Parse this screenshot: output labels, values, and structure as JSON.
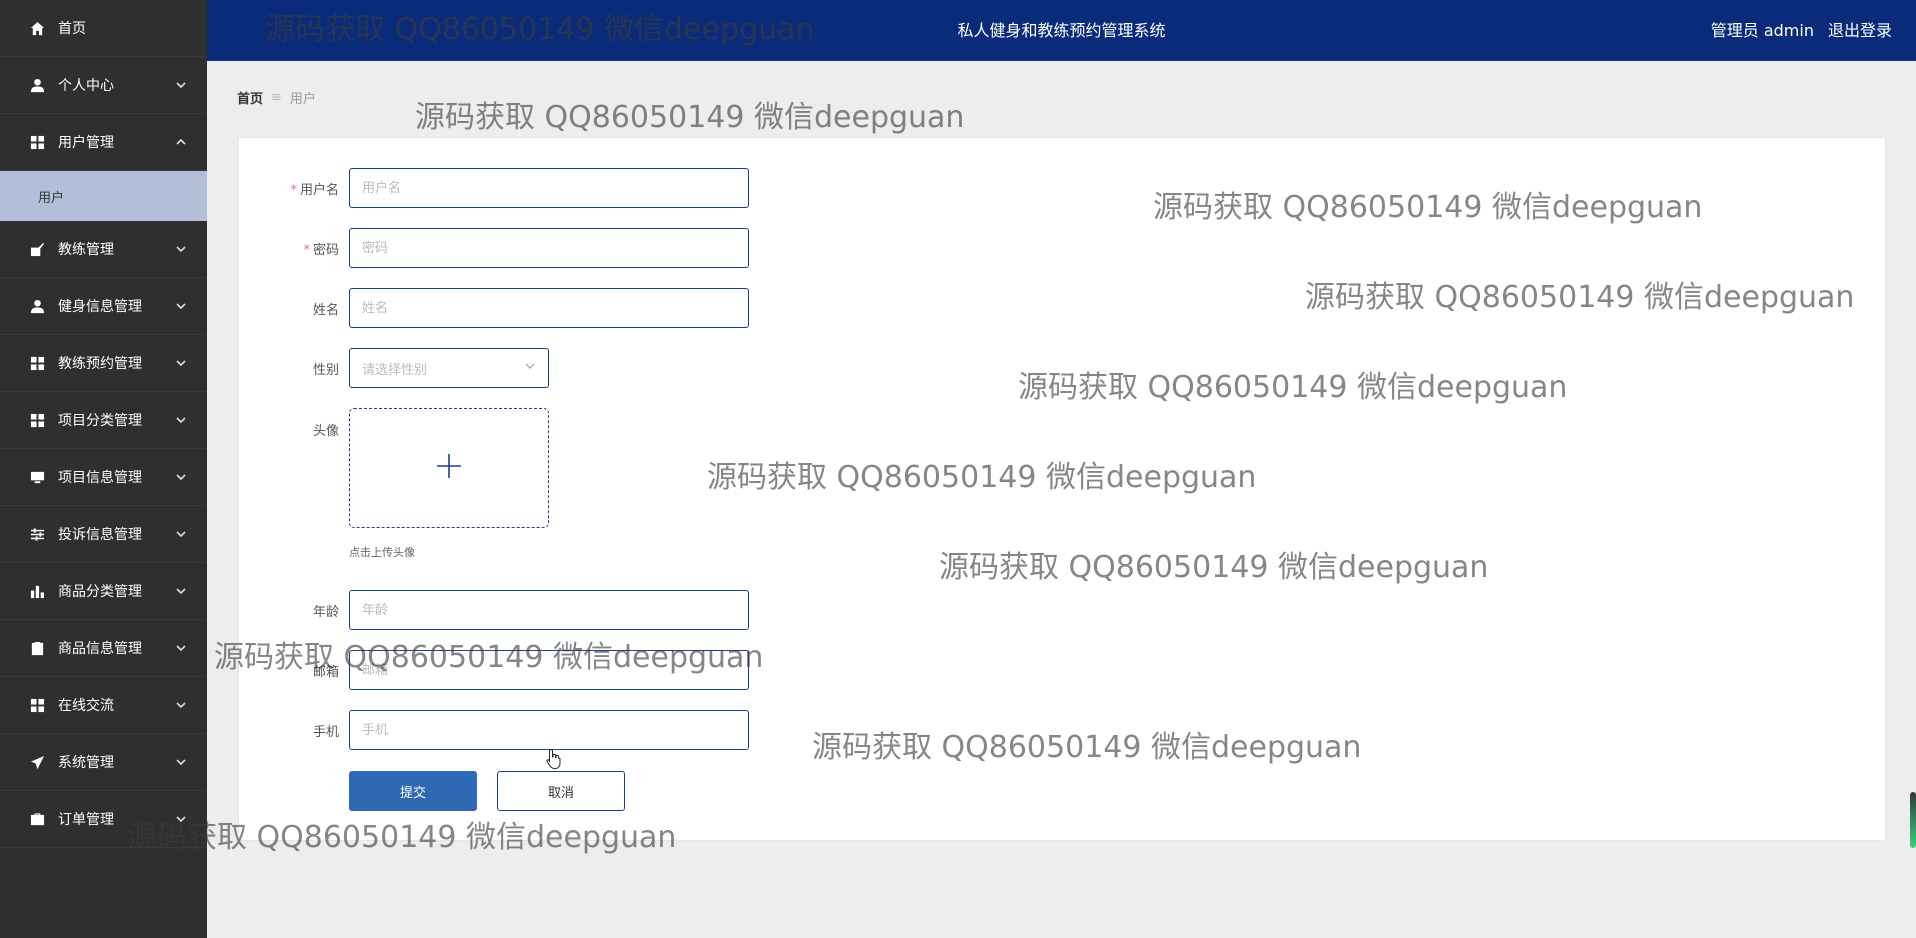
{
  "sidebar": {
    "items": [
      {
        "label": "首页",
        "icon": "home-icon",
        "chevron": "none"
      },
      {
        "label": "个人中心",
        "icon": "person-icon",
        "chevron": "down"
      },
      {
        "label": "用户管理",
        "icon": "grid-icon",
        "chevron": "up"
      },
      {
        "label": "教练管理",
        "icon": "coach-icon",
        "chevron": "down"
      },
      {
        "label": "健身信息管理",
        "icon": "person-icon",
        "chevron": "down"
      },
      {
        "label": "教练预约管理",
        "icon": "grid-icon",
        "chevron": "down"
      },
      {
        "label": "项目分类管理",
        "icon": "grid-icon",
        "chevron": "down"
      },
      {
        "label": "项目信息管理",
        "icon": "monitor-icon",
        "chevron": "down"
      },
      {
        "label": "投诉信息管理",
        "icon": "sliders-icon",
        "chevron": "down"
      },
      {
        "label": "商品分类管理",
        "icon": "bar-chart-icon",
        "chevron": "down"
      },
      {
        "label": "商品信息管理",
        "icon": "clipboard-icon",
        "chevron": "down"
      },
      {
        "label": "在线交流",
        "icon": "grid-icon",
        "chevron": "down"
      },
      {
        "label": "系统管理",
        "icon": "send-icon",
        "chevron": "down"
      },
      {
        "label": "订单管理",
        "icon": "briefcase-icon",
        "chevron": "down"
      }
    ],
    "submenu_active": "用户"
  },
  "header": {
    "title": "私人健身和教练预约管理系统",
    "user": "管理员 admin",
    "logout": "退出登录"
  },
  "breadcrumb": {
    "home": "首页",
    "separator": "≡",
    "current": "用户"
  },
  "form": {
    "username": {
      "label": "用户名",
      "placeholder": "用户名",
      "value": "",
      "required": true
    },
    "password": {
      "label": "密码",
      "placeholder": "密码",
      "value": "",
      "required": true
    },
    "name": {
      "label": "姓名",
      "placeholder": "姓名",
      "value": ""
    },
    "gender": {
      "label": "性别",
      "placeholder": "请选择性别"
    },
    "avatar": {
      "label": "头像",
      "tip": "点击上传头像"
    },
    "age": {
      "label": "年龄",
      "placeholder": "年龄",
      "value": ""
    },
    "email": {
      "label": "邮箱",
      "placeholder": "邮箱",
      "value": ""
    },
    "phone": {
      "label": "手机",
      "placeholder": "手机",
      "value": ""
    },
    "submit_label": "提交",
    "cancel_label": "取消"
  },
  "watermark": "源码获取 QQ86050149 微信deepguan",
  "colors": {
    "sidebar_bg": "#2f2f2f",
    "header_bg": "#0a2a7a",
    "submenu_active_bg": "#b3bfd9",
    "primary_button": "#2f69b4",
    "input_border": "#1d3f8c",
    "required_mark": "#f56c6c"
  }
}
